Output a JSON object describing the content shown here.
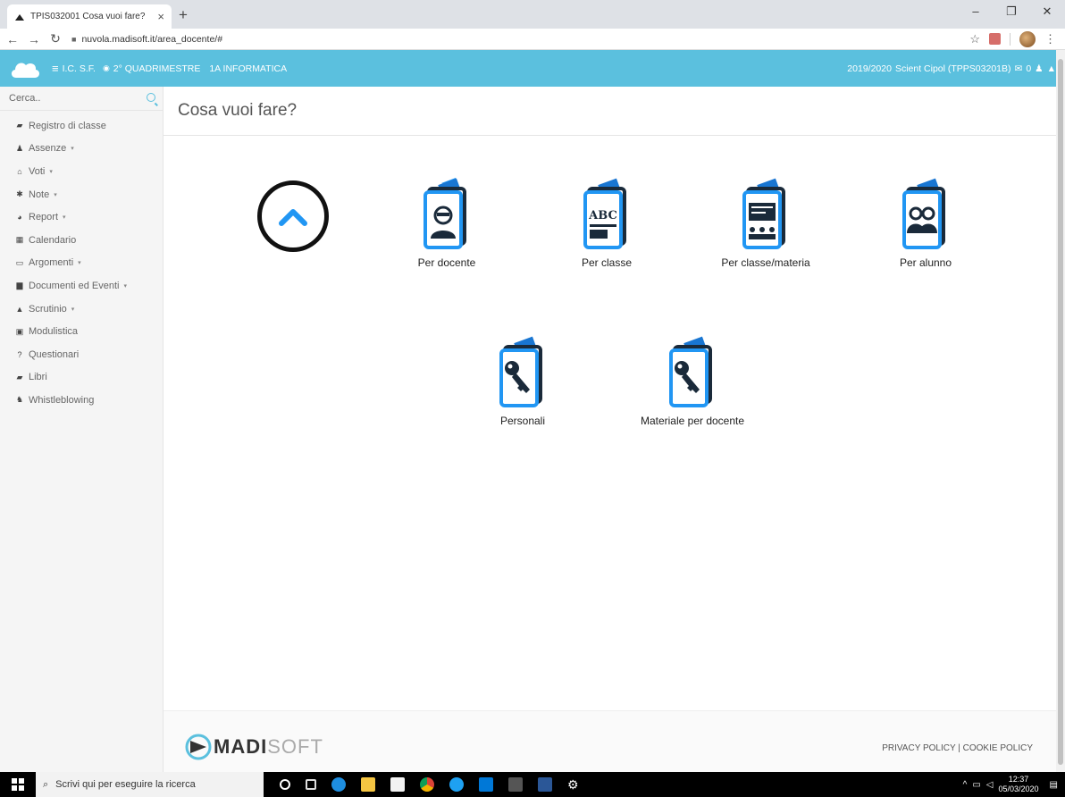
{
  "browser": {
    "tab_title": "TPIS032001 Cosa vuoi fare?",
    "tab_close": "×",
    "new_tab": "+",
    "url": "nuvola.madisoft.it/area_docente/#",
    "window_controls": [
      "–",
      "❐",
      "✕"
    ]
  },
  "header": {
    "menu_glyph": "≡",
    "school": "I.C. S.F.",
    "eye_glyph": "◉",
    "period": "2° QUADRIMESTRE",
    "class": "1A INFORMATICA",
    "year": "2019/2020",
    "user": "Scient Cipol (TPPS03201B)",
    "mail_glyph": "✉",
    "mail_count": "0"
  },
  "sidebar": {
    "search_placeholder": "Cerca..",
    "items": [
      {
        "icon": "book-icon",
        "glyph": "▰",
        "label": "Registro di classe",
        "caret": ""
      },
      {
        "icon": "user-icon",
        "glyph": "♟",
        "label": "Assenze",
        "caret": "▾"
      },
      {
        "icon": "bank-icon",
        "glyph": "⌂",
        "label": "Voti",
        "caret": "▾"
      },
      {
        "icon": "pin-icon",
        "glyph": "✱",
        "label": "Note",
        "caret": "▾"
      },
      {
        "icon": "pie-chart-icon",
        "glyph": "◕",
        "label": "Report",
        "caret": "▾"
      },
      {
        "icon": "calendar-icon",
        "glyph": "▦",
        "label": "Calendario",
        "caret": ""
      },
      {
        "icon": "folder-open-icon",
        "glyph": "▭",
        "label": "Argomenti",
        "caret": "▾"
      },
      {
        "icon": "inbox-icon",
        "glyph": "▆",
        "label": "Documenti ed Eventi",
        "caret": "▾"
      },
      {
        "icon": "graduation-cap-icon",
        "glyph": "▲",
        "label": "Scrutinio",
        "caret": "▾"
      },
      {
        "icon": "briefcase-icon",
        "glyph": "▣",
        "label": "Modulistica",
        "caret": ""
      },
      {
        "icon": "question-icon",
        "glyph": "?",
        "label": "Questionari",
        "caret": ""
      },
      {
        "icon": "book-icon",
        "glyph": "▰",
        "label": "Libri",
        "caret": ""
      },
      {
        "icon": "user-secret-icon",
        "glyph": "♞",
        "label": "Whistleblowing",
        "caret": ""
      }
    ]
  },
  "main": {
    "title": "Cosa vuoi fare?",
    "options": [
      {
        "label": "Per docente",
        "icon": "teacher-report-icon"
      },
      {
        "label": "Per classe",
        "icon": "class-report-icon"
      },
      {
        "label": "Per classe/materia",
        "icon": "class-subject-report-icon"
      },
      {
        "label": "Per alunno",
        "icon": "student-report-icon"
      },
      {
        "label": "Personali",
        "icon": "key-personal-icon"
      },
      {
        "label": "Materiale per docente",
        "icon": "key-material-icon"
      }
    ]
  },
  "footer": {
    "logo_bold": "MADI",
    "logo_light": "SOFT",
    "privacy": "PRIVACY POLICY",
    "separator": "|",
    "cookie": "COOKIE POLICY"
  },
  "taskbar": {
    "search_placeholder": "Scrivi qui per eseguire la ricerca",
    "time": "12:37",
    "date": "05/03/2020"
  },
  "colors": {
    "header": "#5bc0de",
    "accent": "#2196f3",
    "icon_dark": "#1a2a3a"
  }
}
